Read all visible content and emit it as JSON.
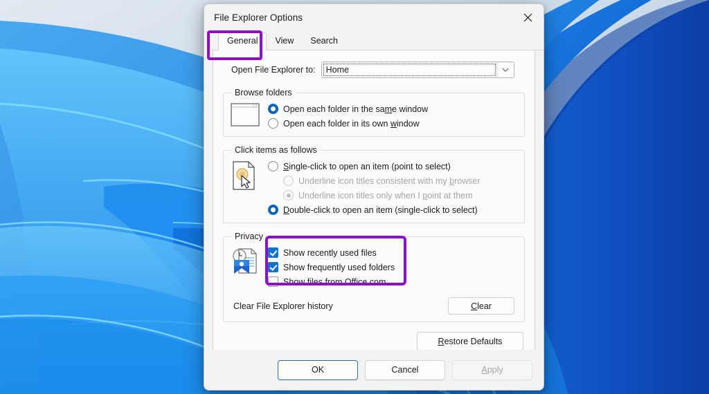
{
  "window": {
    "title": "File Explorer Options",
    "close_icon": "close-icon"
  },
  "tabs": [
    {
      "label": "General",
      "active": true
    },
    {
      "label": "View",
      "active": false
    },
    {
      "label": "Search",
      "active": false
    }
  ],
  "annotations": {
    "color": "#8E0FCB",
    "highlighted": [
      "General tab",
      "Show recently used files",
      "Show frequently used folders"
    ]
  },
  "general": {
    "open_to": {
      "label": "Open File Explorer to:",
      "value": "Home",
      "dropdown_icon": "chevron-down-icon"
    },
    "browse_folders": {
      "legend": "Browse folders",
      "icon": "window-folder-icon",
      "options": [
        {
          "label_pre": "Open each folder in the sa",
          "accel": "m",
          "label_post": "e window",
          "checked": true
        },
        {
          "label_pre": "Open each folder in its own ",
          "accel": "w",
          "label_post": "indow",
          "checked": false
        }
      ]
    },
    "click_items": {
      "legend": "Click items as follows",
      "icon": "document-pointer-icon",
      "options": [
        {
          "accel_first": "S",
          "label_post": "ingle-click to open an item (point to select)",
          "checked": false,
          "disabled": false,
          "indent": false
        },
        {
          "label_pre": "Underline icon titles consistent with my ",
          "accel": "b",
          "label_post": "rowser",
          "checked": false,
          "disabled": true,
          "indent": true
        },
        {
          "label_pre": "Underline icon titles only when I ",
          "accel": "p",
          "label_post": "oint at them",
          "checked": true,
          "disabled": true,
          "indent": true
        },
        {
          "accel_first": "D",
          "label_post": "ouble-click to open an item (single-click to select)",
          "checked": true,
          "disabled": false,
          "indent": false
        }
      ]
    },
    "privacy": {
      "legend": "Privacy",
      "icon": "document-clock-bookmark-icon",
      "checkboxes": [
        {
          "label": "Show recently used files",
          "checked": true,
          "highlighted": true
        },
        {
          "label": "Show frequently used folders",
          "checked": true,
          "highlighted": true
        },
        {
          "label": "Show files from Office.com",
          "checked": false,
          "highlighted": false
        }
      ],
      "clear_label": "Clear File Explorer history",
      "clear_button": {
        "accel_first": "C",
        "label_post": "lear"
      }
    },
    "restore_defaults": {
      "accel_first": "R",
      "label_post": "estore Defaults"
    }
  },
  "footer": {
    "ok": "OK",
    "cancel": "Cancel",
    "apply": {
      "accel_first": "A",
      "label_post": "pply",
      "disabled": true
    }
  }
}
